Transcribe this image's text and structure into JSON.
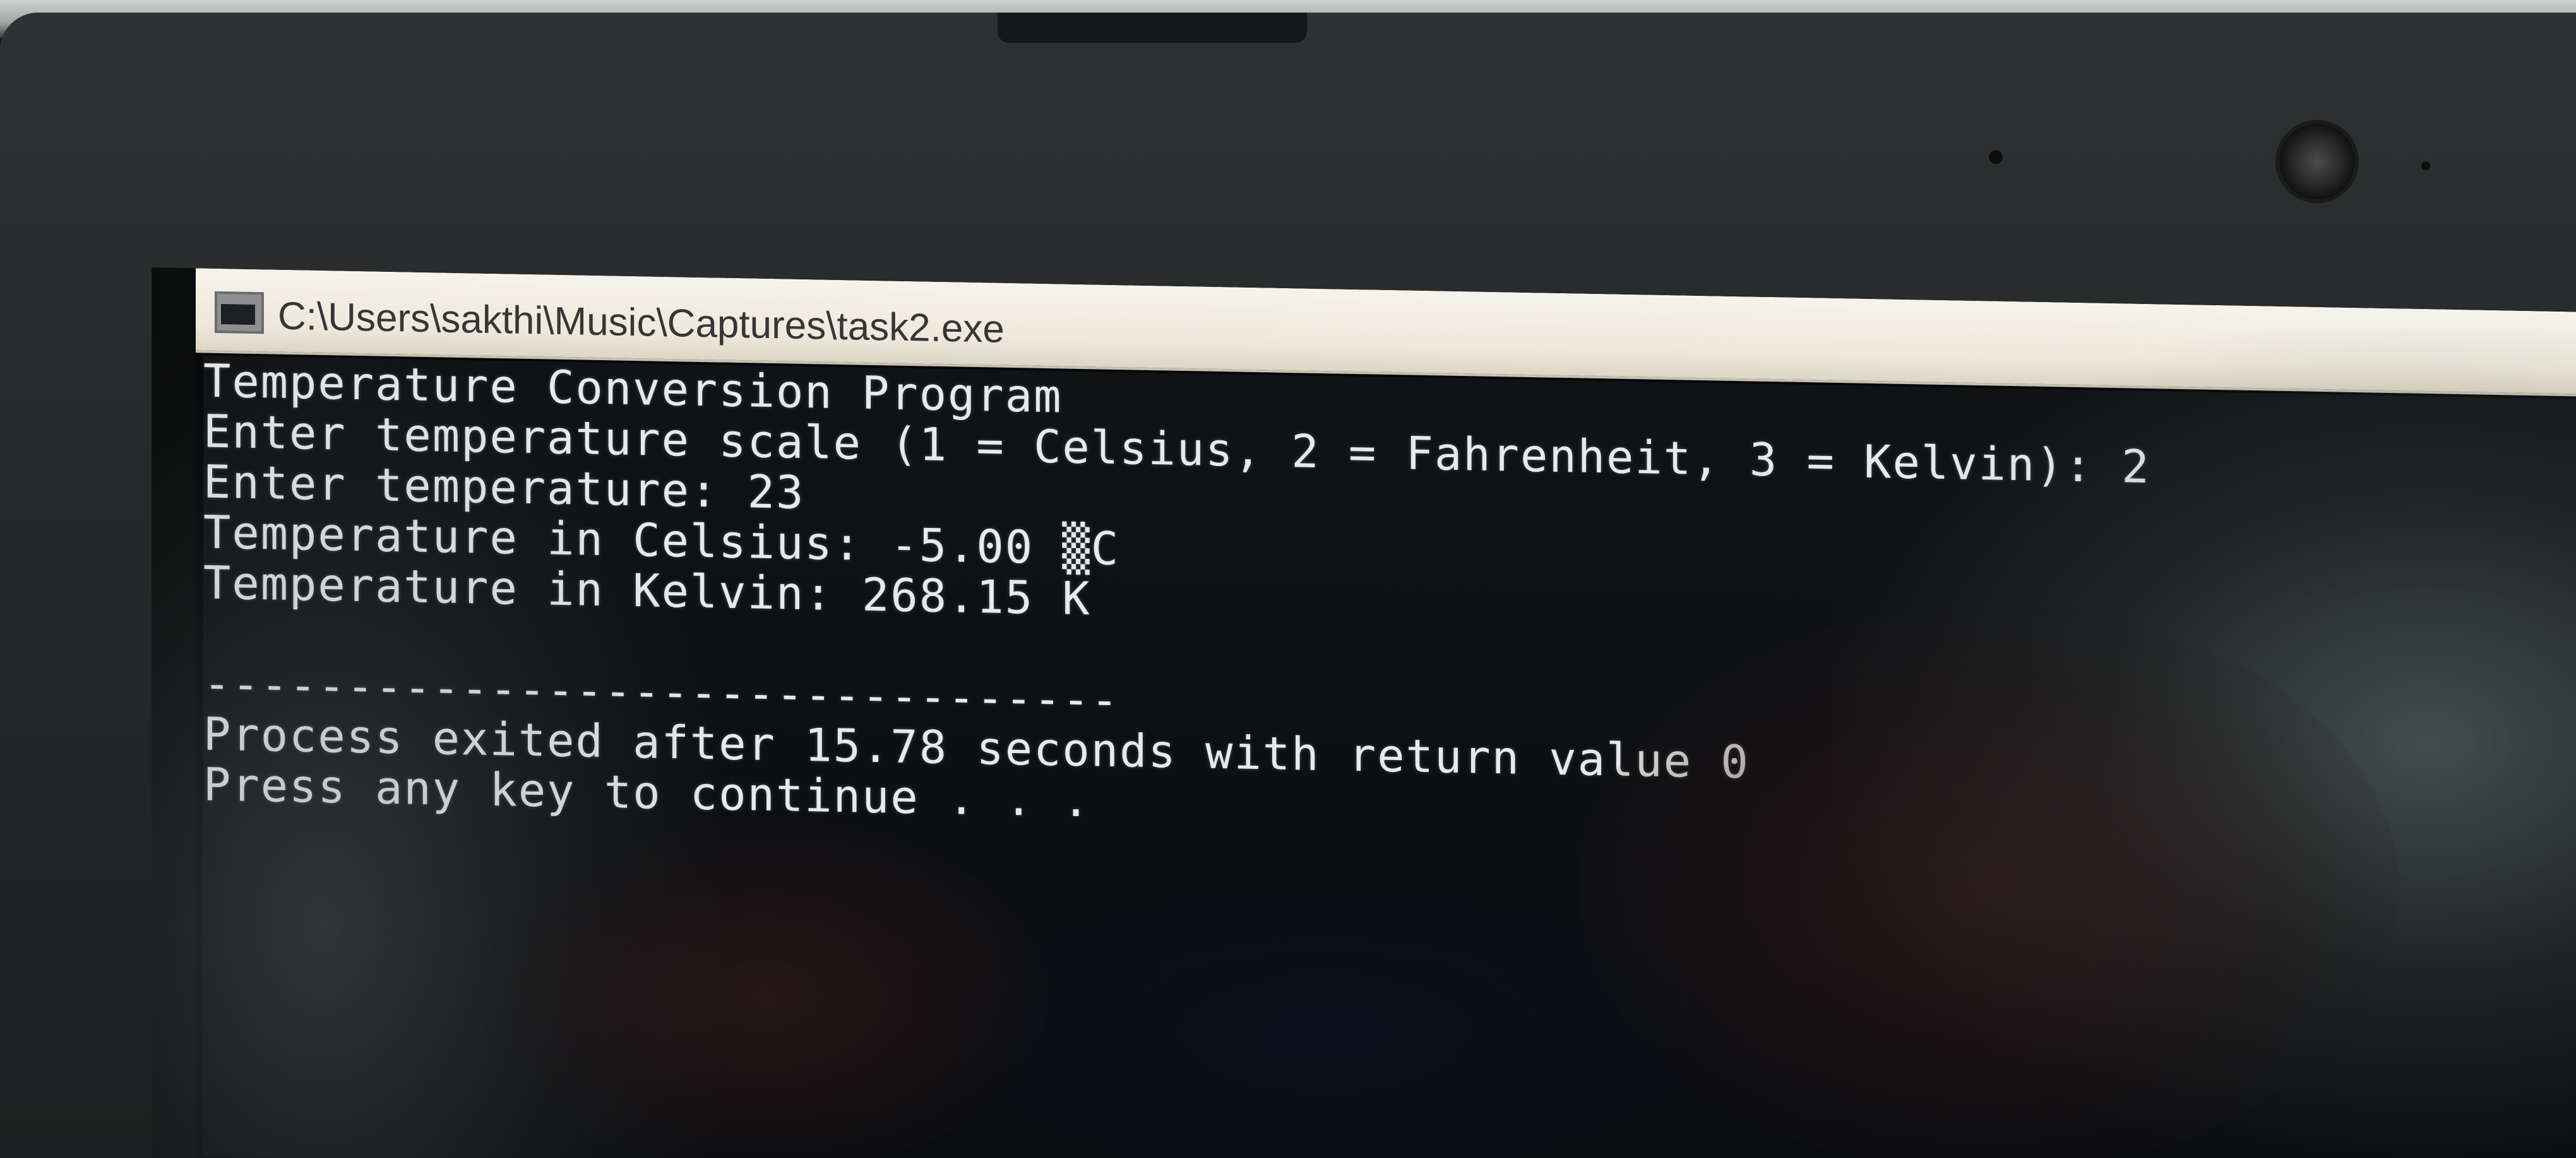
{
  "window": {
    "title": "C:\\Users\\sakthi\\Music\\Captures\\task2.exe"
  },
  "console": {
    "lines": [
      "Temperature Conversion Program",
      "Enter temperature scale (1 = Celsius, 2 = Fahrenheit, 3 = Kelvin): 2",
      "Enter temperature: 23",
      "Temperature in Celsius: -5.00 ▒C",
      "Temperature in Kelvin: 268.15 K",
      "",
      "--------------------------------",
      "Process exited after 15.78 seconds with return value 0",
      "Press any key to continue . . ."
    ]
  },
  "icons": {
    "app_icon": "console-window-icon",
    "webcam": "webcam-icon"
  }
}
